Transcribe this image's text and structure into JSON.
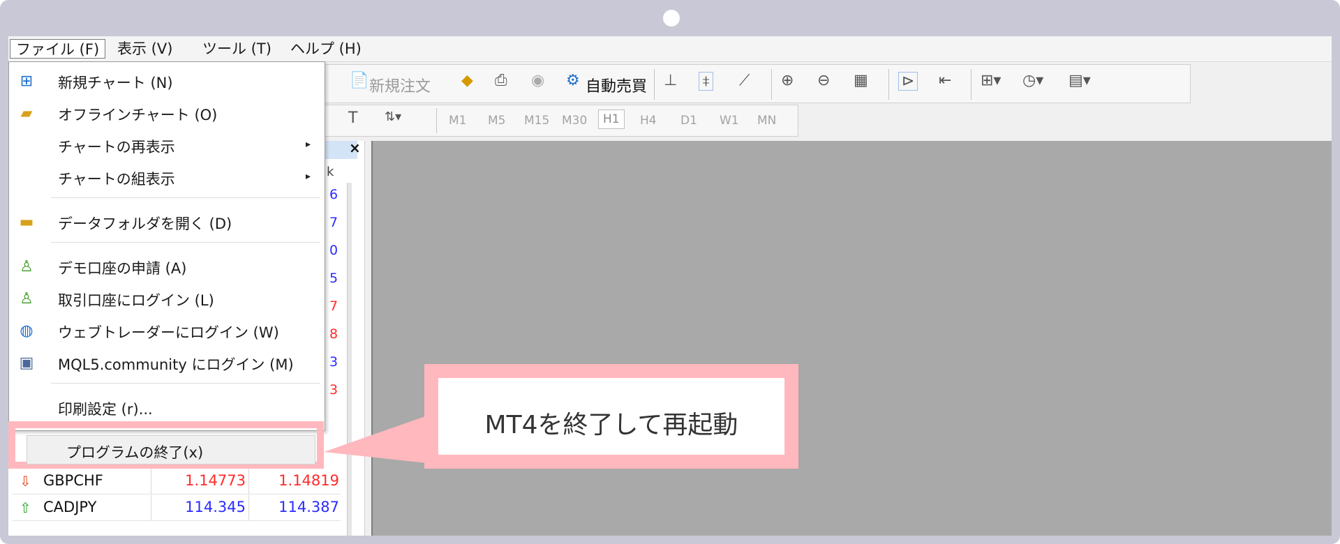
{
  "menubar": {
    "items": [
      "ファイル (F)",
      "表示 (V)",
      "ツール (T)",
      "ヘルプ (H)"
    ]
  },
  "toolbar": {
    "new_order": "新規注文",
    "auto_trading": "自動売買",
    "timeframes": [
      "M1",
      "M5",
      "M15",
      "M30",
      "H1",
      "H4",
      "D1",
      "W1",
      "MN"
    ],
    "active_timeframe": "H1"
  },
  "file_menu": {
    "items": [
      {
        "label": "新規チャート (N)",
        "icon": "new-chart-icon"
      },
      {
        "label": "オフラインチャート (O)",
        "icon": "open-folder-icon"
      },
      {
        "label": "チャートの再表示",
        "icon": "",
        "submenu": true
      },
      {
        "label": "チャートの組表示",
        "icon": "",
        "submenu": true
      },
      {
        "label": "データフォルダを開く (D)",
        "icon": "folder-icon"
      },
      {
        "label": "デモ口座の申請 (A)",
        "icon": "add-user-icon"
      },
      {
        "label": "取引口座にログイン (L)",
        "icon": "login-user-icon"
      },
      {
        "label": "ウェブトレーダーにログイン (W)",
        "icon": "globe-icon"
      },
      {
        "label": "MQL5.community にログイン (M)",
        "icon": "mql5-icon"
      },
      {
        "label": "印刷設定 (r)...",
        "icon": ""
      },
      {
        "label": "プログラムの終了(x)",
        "icon": ""
      }
    ]
  },
  "market_watch": {
    "column_edge": "k",
    "close": "×",
    "edge_values": [
      {
        "text": "6",
        "color": "blue"
      },
      {
        "text": "7",
        "color": "blue"
      },
      {
        "text": "0",
        "color": "blue"
      },
      {
        "text": "5",
        "color": "blue"
      },
      {
        "text": "7",
        "color": "red"
      },
      {
        "text": "8",
        "color": "red"
      },
      {
        "text": "3",
        "color": "blue"
      },
      {
        "text": "3",
        "color": "red"
      }
    ],
    "rows": [
      {
        "symbol": "GBPCHF",
        "bid": "1.14773",
        "ask": "1.14819",
        "direction": "down",
        "color": "red"
      },
      {
        "symbol": "CADJPY",
        "bid": "114.345",
        "ask": "114.387",
        "direction": "up",
        "color": "blue"
      }
    ]
  },
  "callout": {
    "text": "MT4を終了して再起動"
  },
  "colors": {
    "highlight": "#ffb8bd",
    "chart_bg": "#a9a9a9",
    "frame": "#c9c8d6"
  }
}
